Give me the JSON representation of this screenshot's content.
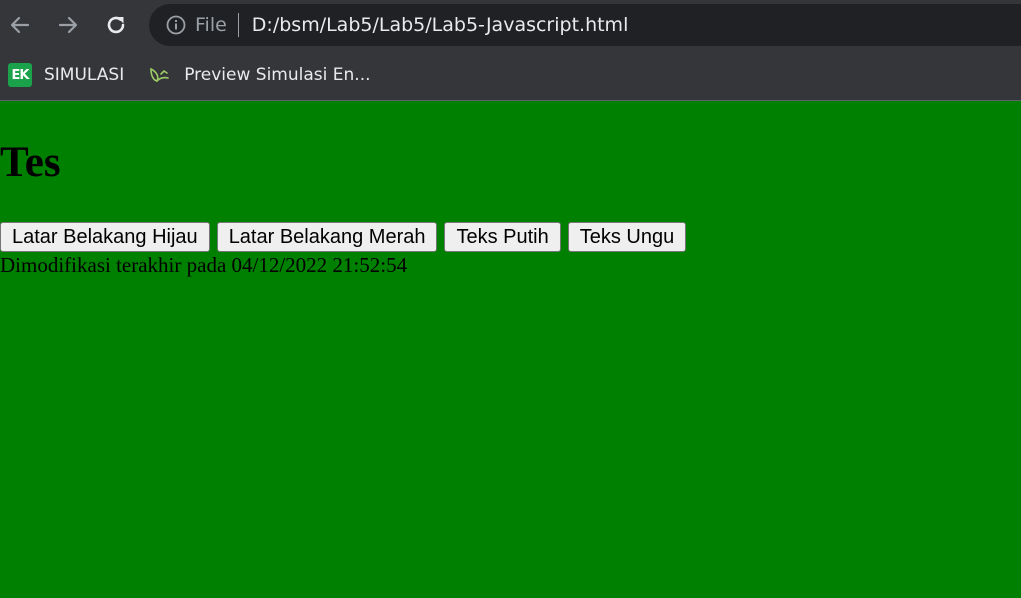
{
  "browser": {
    "scheme_label": "File",
    "url": "D:/bsm/Lab5/Lab5/Lab5-Javascript.html",
    "bookmarks": [
      {
        "label": "SIMULASI",
        "favicon_text": "EK",
        "icon": "ek-favicon-icon"
      },
      {
        "label": "Preview Simulasi En...",
        "icon": "leaf-favicon-icon"
      }
    ],
    "nav_icons": [
      "back-arrow-icon",
      "forward-arrow-icon",
      "reload-icon",
      "info-icon"
    ]
  },
  "page": {
    "heading": "Tes",
    "buttons": [
      {
        "label": "Latar Belakang Hijau"
      },
      {
        "label": "Latar Belakang Merah"
      },
      {
        "label": "Teks Putih"
      },
      {
        "label": "Teks Ungu"
      }
    ],
    "modified_text": "Dimodifikasi terakhir pada 04/12/2022 21:52:54",
    "background_color": "#008000",
    "text_color": "#000000"
  }
}
